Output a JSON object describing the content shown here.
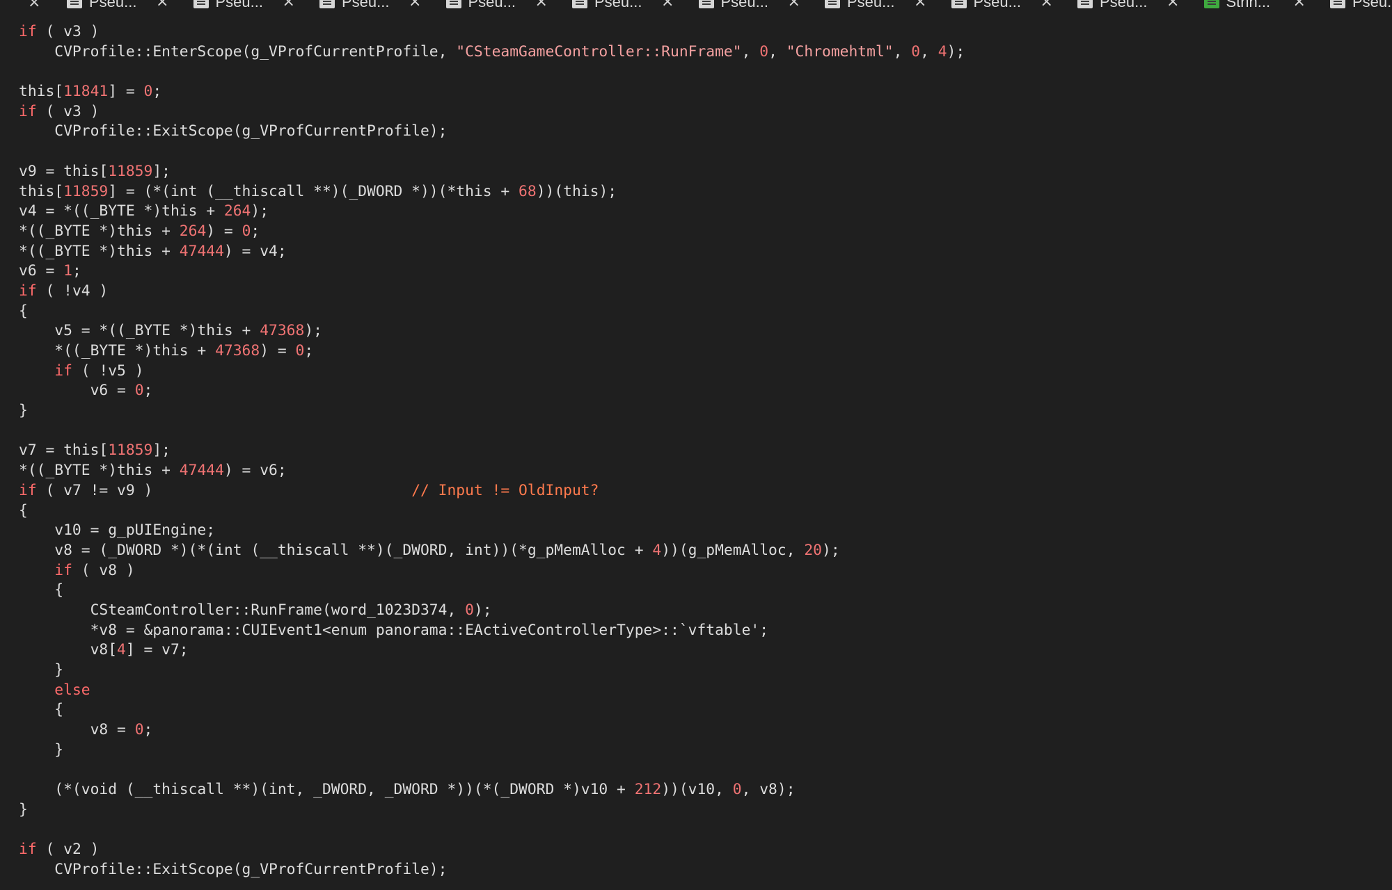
{
  "tabs": [
    {
      "label": "Pseu...",
      "icon": "pseudocode-icon"
    },
    {
      "label": "Pseu...",
      "icon": "pseudocode-icon"
    },
    {
      "label": "Pseu...",
      "icon": "pseudocode-icon"
    },
    {
      "label": "Pseu...",
      "icon": "pseudocode-icon"
    },
    {
      "label": "Pseu...",
      "icon": "pseudocode-icon"
    },
    {
      "label": "Pseu...",
      "icon": "pseudocode-icon"
    },
    {
      "label": "Pseu...",
      "icon": "pseudocode-icon"
    },
    {
      "label": "Pseu...",
      "icon": "pseudocode-icon"
    },
    {
      "label": "Pseu...",
      "icon": "pseudocode-icon"
    },
    {
      "label": "Strin...",
      "icon": "strings-icon"
    },
    {
      "label": "Pseu...",
      "icon": "pseudocode-icon"
    }
  ],
  "colors": {
    "background": "#1f1f1f",
    "text": "#dcdcdc",
    "keyword": "#ff6b6b",
    "number": "#f07373",
    "string": "#f4a0a0",
    "comment": "#ff7a4d"
  },
  "code_lines": [
    [
      [
        "kw",
        "if"
      ],
      [
        "txt",
        " ( v3 )"
      ]
    ],
    [
      [
        "txt",
        "    CVProfile::EnterScope(g_VProfCurrentProfile, "
      ],
      [
        "str",
        "\"CSteamGameController::RunFrame\""
      ],
      [
        "txt",
        ", "
      ],
      [
        "num",
        "0"
      ],
      [
        "txt",
        ", "
      ],
      [
        "str",
        "\"Chromehtml\""
      ],
      [
        "txt",
        ", "
      ],
      [
        "num",
        "0"
      ],
      [
        "txt",
        ", "
      ],
      [
        "num",
        "4"
      ],
      [
        "txt",
        ");"
      ]
    ],
    [],
    [
      [
        "txt",
        "this["
      ],
      [
        "num",
        "11841"
      ],
      [
        "txt",
        "] = "
      ],
      [
        "num",
        "0"
      ],
      [
        "txt",
        ";"
      ]
    ],
    [
      [
        "kw",
        "if"
      ],
      [
        "txt",
        " ( v3 )"
      ]
    ],
    [
      [
        "txt",
        "    CVProfile::ExitScope(g_VProfCurrentProfile);"
      ]
    ],
    [],
    [
      [
        "txt",
        "v9 = this["
      ],
      [
        "num",
        "11859"
      ],
      [
        "txt",
        "];"
      ]
    ],
    [
      [
        "txt",
        "this["
      ],
      [
        "num",
        "11859"
      ],
      [
        "txt",
        "] = (*(int (__thiscall **)(_DWORD *))(*this + "
      ],
      [
        "num",
        "68"
      ],
      [
        "txt",
        "))(this);"
      ]
    ],
    [
      [
        "txt",
        "v4 = *((_BYTE *)this + "
      ],
      [
        "num",
        "264"
      ],
      [
        "txt",
        ");"
      ]
    ],
    [
      [
        "txt",
        "*((_BYTE *)this + "
      ],
      [
        "num",
        "264"
      ],
      [
        "txt",
        ") = "
      ],
      [
        "num",
        "0"
      ],
      [
        "txt",
        ";"
      ]
    ],
    [
      [
        "txt",
        "*((_BYTE *)this + "
      ],
      [
        "num",
        "47444"
      ],
      [
        "txt",
        ") = v4;"
      ]
    ],
    [
      [
        "txt",
        "v6 = "
      ],
      [
        "num",
        "1"
      ],
      [
        "txt",
        ";"
      ]
    ],
    [
      [
        "kw",
        "if"
      ],
      [
        "txt",
        " ( !v4 )"
      ]
    ],
    [
      [
        "txt",
        "{"
      ]
    ],
    [
      [
        "txt",
        "    v5 = *((_BYTE *)this + "
      ],
      [
        "num",
        "47368"
      ],
      [
        "txt",
        ");"
      ]
    ],
    [
      [
        "txt",
        "    *((_BYTE *)this + "
      ],
      [
        "num",
        "47368"
      ],
      [
        "txt",
        ") = "
      ],
      [
        "num",
        "0"
      ],
      [
        "txt",
        ";"
      ]
    ],
    [
      [
        "txt",
        "    "
      ],
      [
        "kw",
        "if"
      ],
      [
        "txt",
        " ( !v5 )"
      ]
    ],
    [
      [
        "txt",
        "        v6 = "
      ],
      [
        "num",
        "0"
      ],
      [
        "txt",
        ";"
      ]
    ],
    [
      [
        "txt",
        "}"
      ]
    ],
    [],
    [
      [
        "txt",
        "v7 = this["
      ],
      [
        "num",
        "11859"
      ],
      [
        "txt",
        "];"
      ]
    ],
    [
      [
        "txt",
        "*((_BYTE *)this + "
      ],
      [
        "num",
        "47444"
      ],
      [
        "txt",
        ") = v6;"
      ]
    ],
    [
      [
        "kw",
        "if"
      ],
      [
        "txt",
        " ( v7 != v9 )                             "
      ],
      [
        "cmt",
        "// Input != OldInput?"
      ]
    ],
    [
      [
        "txt",
        "{"
      ]
    ],
    [
      [
        "txt",
        "    v10 = g_pUIEngine;"
      ]
    ],
    [
      [
        "txt",
        "    v8 = (_DWORD *)(*(int (__thiscall **)(_DWORD, int))(*g_pMemAlloc + "
      ],
      [
        "num",
        "4"
      ],
      [
        "txt",
        "))(g_pMemAlloc, "
      ],
      [
        "num",
        "20"
      ],
      [
        "txt",
        ");"
      ]
    ],
    [
      [
        "txt",
        "    "
      ],
      [
        "kw",
        "if"
      ],
      [
        "txt",
        " ( v8 )"
      ]
    ],
    [
      [
        "txt",
        "    {"
      ]
    ],
    [
      [
        "txt",
        "        CSteamController::RunFrame(word_1023D374, "
      ],
      [
        "num",
        "0"
      ],
      [
        "txt",
        ");"
      ]
    ],
    [
      [
        "txt",
        "        *v8 = &panorama::CUIEvent1<enum panorama::EActiveControllerType>::`vftable';"
      ]
    ],
    [
      [
        "txt",
        "        v8["
      ],
      [
        "num",
        "4"
      ],
      [
        "txt",
        "] = v7;"
      ]
    ],
    [
      [
        "txt",
        "    }"
      ]
    ],
    [
      [
        "txt",
        "    "
      ],
      [
        "kw",
        "else"
      ]
    ],
    [
      [
        "txt",
        "    {"
      ]
    ],
    [
      [
        "txt",
        "        v8 = "
      ],
      [
        "num",
        "0"
      ],
      [
        "txt",
        ";"
      ]
    ],
    [
      [
        "txt",
        "    }"
      ]
    ],
    [],
    [
      [
        "txt",
        "    (*(void (__thiscall **)(int, _DWORD, _DWORD *))(*(_DWORD *)v10 + "
      ],
      [
        "num",
        "212"
      ],
      [
        "txt",
        "))(v10, "
      ],
      [
        "num",
        "0"
      ],
      [
        "txt",
        ", v8);"
      ]
    ],
    [
      [
        "txt",
        "}"
      ]
    ],
    [],
    [
      [
        "kw",
        "if"
      ],
      [
        "txt",
        " ( v2 )"
      ]
    ],
    [
      [
        "txt",
        "    CVProfile::ExitScope(g_VProfCurrentProfile);"
      ]
    ]
  ]
}
